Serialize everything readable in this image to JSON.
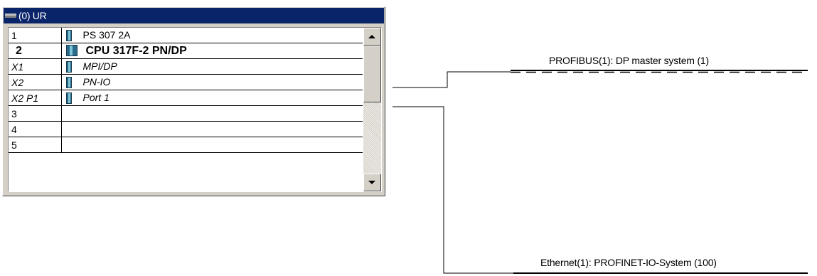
{
  "rack": {
    "title": "(0) UR",
    "title_icon": "rack-icon",
    "slots": [
      {
        "slot": "1",
        "module": "PS 307 2A",
        "style": "normal",
        "icon": "module-icon"
      },
      {
        "slot": "2",
        "module": "CPU 317F-2 PN/DP",
        "style": "bold",
        "icon": "cpu-module-icon"
      },
      {
        "slot": "X1",
        "module": "MPI/DP",
        "style": "italic",
        "icon": "interface-icon"
      },
      {
        "slot": "X2",
        "module": "PN-IO",
        "style": "italic",
        "icon": "interface-icon"
      },
      {
        "slot": "X2 P1",
        "module": "Port 1",
        "style": "italic",
        "icon": "port-icon"
      },
      {
        "slot": "3",
        "module": "",
        "style": "normal",
        "icon": ""
      },
      {
        "slot": "4",
        "module": "",
        "style": "normal",
        "icon": ""
      },
      {
        "slot": "5",
        "module": "",
        "style": "normal",
        "icon": ""
      }
    ]
  },
  "scrollbar": {
    "up_icon": "arrow-up-icon",
    "down_icon": "arrow-down-icon"
  },
  "networks": {
    "profibus_label": "PROFIBUS(1): DP master system (1)",
    "ethernet_label": "Ethernet(1): PROFINET-IO-System (100)"
  },
  "colors": {
    "title_bar": "#0a246a",
    "window_face": "#d4d0c8",
    "line": "#000000"
  }
}
